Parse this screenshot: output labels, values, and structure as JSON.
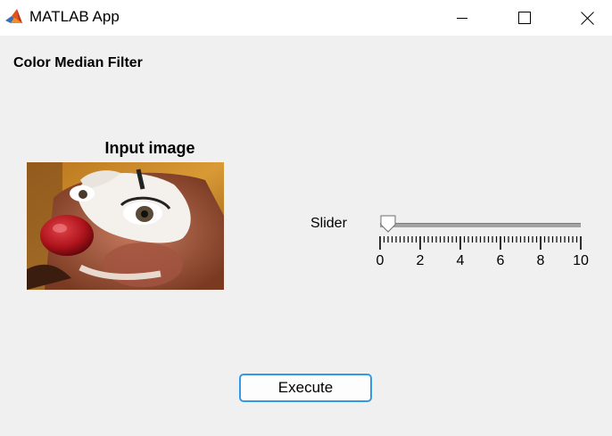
{
  "window": {
    "title": "MATLAB App",
    "icon": "matlab-logo-icon"
  },
  "app": {
    "heading": "Color Median Filter"
  },
  "input_axes": {
    "title": "Input image",
    "image": "clown face photo"
  },
  "slider": {
    "label": "Slider",
    "min": 0,
    "max": 10,
    "value": 0.4,
    "major_ticks": [
      0,
      2,
      4,
      6,
      8,
      10
    ],
    "tick_labels": [
      "0",
      "2",
      "4",
      "6",
      "8",
      "10"
    ]
  },
  "buttons": {
    "execute_label": "Execute"
  },
  "colors": {
    "button_border": "#3399e6",
    "window_background": "#f0f0f0"
  }
}
